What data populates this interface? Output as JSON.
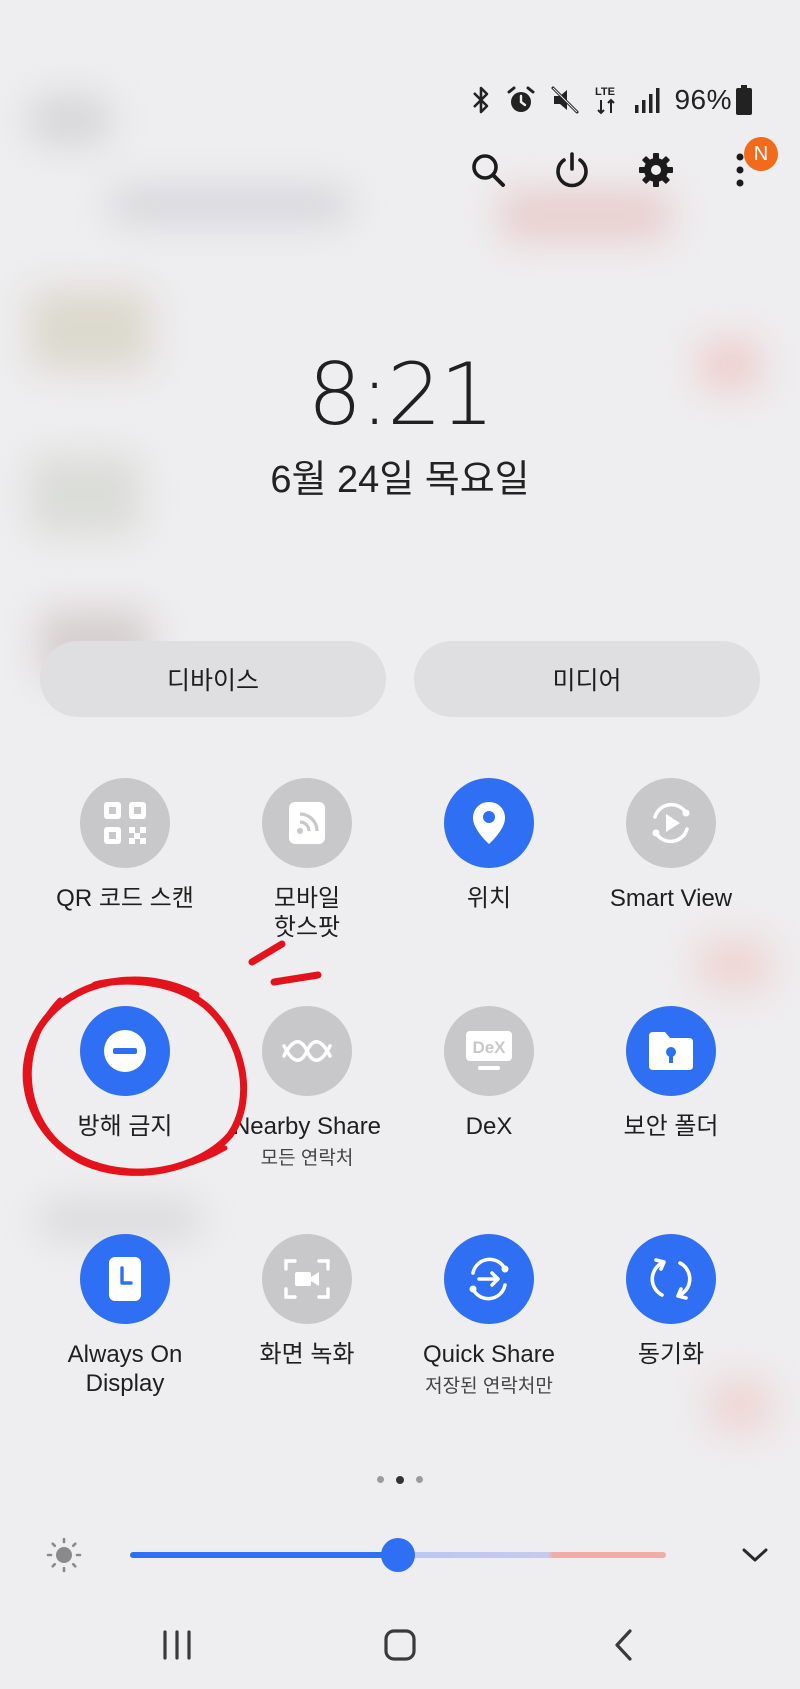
{
  "status_bar": {
    "battery_percent": "96%",
    "icons": [
      "bluetooth-icon",
      "alarm-icon",
      "mute-icon",
      "lte-icon",
      "signal-icon",
      "battery-icon"
    ]
  },
  "top_actions": [
    {
      "name": "search-icon"
    },
    {
      "name": "power-icon"
    },
    {
      "name": "gear-icon"
    },
    {
      "name": "more-options-icon",
      "badge": "N"
    }
  ],
  "clock": {
    "time": "8:21",
    "date": "6월 24일 목요일"
  },
  "segments": {
    "devices": "디바이스",
    "media": "미디어"
  },
  "tiles": [
    {
      "id": "qr-scan",
      "label": "QR 코드 스캔",
      "sub": "",
      "state": "off",
      "icon": "qr-code-icon"
    },
    {
      "id": "mobile-hotspot",
      "label": "모바일\n핫스팟",
      "sub": "",
      "state": "off",
      "icon": "hotspot-icon"
    },
    {
      "id": "location",
      "label": "위치",
      "sub": "",
      "state": "on",
      "icon": "location-pin-icon"
    },
    {
      "id": "smart-view",
      "label": "Smart View",
      "sub": "",
      "state": "off",
      "icon": "smart-view-icon"
    },
    {
      "id": "do-not-disturb",
      "label": "방해 금지",
      "sub": "",
      "state": "on",
      "icon": "do-not-disturb-icon"
    },
    {
      "id": "nearby-share",
      "label": "Nearby Share",
      "sub": "모든 연락처",
      "state": "off",
      "icon": "nearby-share-icon"
    },
    {
      "id": "dex",
      "label": "DeX",
      "sub": "",
      "state": "off",
      "icon": "dex-icon"
    },
    {
      "id": "secure-folder",
      "label": "보안 폴더",
      "sub": "",
      "state": "on",
      "icon": "secure-folder-icon"
    },
    {
      "id": "always-on-display",
      "label": "Always On\nDisplay",
      "sub": "",
      "state": "on",
      "icon": "always-on-display-icon"
    },
    {
      "id": "screen-recorder",
      "label": "화면 녹화",
      "sub": "",
      "state": "off",
      "icon": "screen-record-icon"
    },
    {
      "id": "quick-share",
      "label": "Quick Share",
      "sub": "저장된 연락처만",
      "state": "on",
      "icon": "quick-share-icon"
    },
    {
      "id": "sync",
      "label": "동기화",
      "sub": "",
      "state": "on",
      "icon": "sync-icon"
    }
  ],
  "page_indicator": {
    "count": 3,
    "current": 2
  },
  "brightness": {
    "level": 0.5
  },
  "nav": [
    "recents-icon",
    "home-icon",
    "back-icon"
  ],
  "colors": {
    "accent": "#2f6ff3",
    "tile_off": "#c8c7ca",
    "annotation": "#e4131b",
    "badge": "#f36a1b"
  }
}
